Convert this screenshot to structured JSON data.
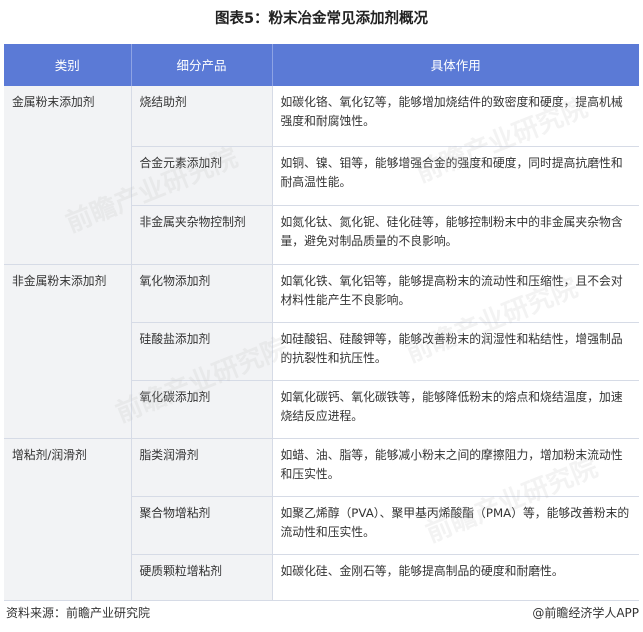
{
  "title": "图表5：粉末冶金常见添加剂概况",
  "table": {
    "headers": [
      "类别",
      "细分产品",
      "具体作用"
    ],
    "groups": [
      {
        "category": "金属粉末添加剂",
        "rows": [
          {
            "product": "烧结助剂",
            "effect": "如碳化铬、氧化钇等，能够增加烧结件的致密度和硬度，提高机械强度和耐腐蚀性。"
          },
          {
            "product": "合金元素添加剂",
            "effect": "如铜、镍、钼等，能够增强合金的强度和硬度，同时提高抗磨性和耐高温性能。"
          },
          {
            "product": "非金属夹杂物控制剂",
            "effect": "如氮化钛、氮化铌、硅化硅等，能够控制粉末中的非金属夹杂物含量，避免对制品质量的不良影响。"
          }
        ]
      },
      {
        "category": "非金属粉末添加剂",
        "rows": [
          {
            "product": "氧化物添加剂",
            "effect": "如氧化铁、氧化铝等，能够提高粉末的流动性和压缩性，且不会对材料性能产生不良影响。"
          },
          {
            "product": "硅酸盐添加剂",
            "effect": "如硅酸铝、硅酸钾等，能够改善粉末的润湿性和粘结性，增强制品的抗裂性和抗压性。"
          },
          {
            "product": "氧化碳添加剂",
            "effect": "如氧化碳钙、氧化碳铁等，能够降低粉末的熔点和烧结温度，加速烧结反应进程。"
          }
        ]
      },
      {
        "category": "增粘剂/润滑剂",
        "rows": [
          {
            "product": "脂类润滑剂",
            "effect": "如蜡、油、脂等，能够减小粉末之间的摩擦阻力，增加粉末流动性和压实性。"
          },
          {
            "product": "聚合物增粘剂",
            "effect": "如聚乙烯醇（PVA）、聚甲基丙烯酸酯（PMA）等，能够改善粉末的流动性和压实性。"
          },
          {
            "product": "硬质颗粒增粘剂",
            "effect": "如碳化硅、金刚石等，能够提高制品的硬度和耐磨性。"
          }
        ]
      }
    ]
  },
  "footer": {
    "source": "资料来源：前瞻产业研究院",
    "brand": "@前瞻经济学人APP"
  },
  "watermark_text": "前瞻产业研究院"
}
